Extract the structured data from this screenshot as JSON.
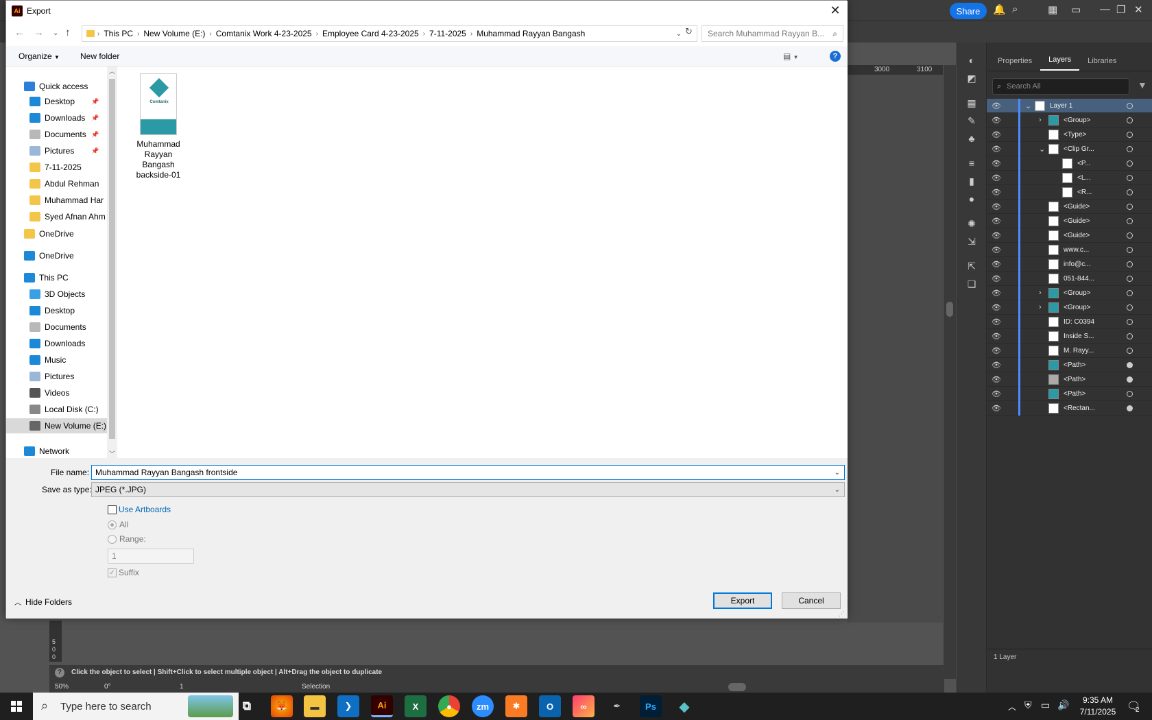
{
  "dialog": {
    "title": "Export",
    "close_glyph": "✕",
    "breadcrumbs": [
      "This PC",
      "New Volume (E:)",
      "Comtanix Work 4-23-2025",
      "Employee Card 4-23-2025",
      "7-11-2025",
      "Muhammad Rayyan Bangash"
    ],
    "search_placeholder": "Search Muhammad Rayyan B...",
    "organize_label": "Organize",
    "new_folder_label": "New folder",
    "help_glyph": "?",
    "nav": {
      "quick_access": "Quick access",
      "quick_items": [
        "Desktop",
        "Downloads",
        "Documents",
        "Pictures",
        "7-11-2025",
        "Abdul Rehman",
        "Muhammad Har",
        "Syed Afnan Ahm"
      ],
      "onedrive1": "OneDrive",
      "onedrive2": "OneDrive",
      "this_pc": "This PC",
      "pc_items": [
        "3D Objects",
        "Desktop",
        "Documents",
        "Downloads",
        "Music",
        "Pictures",
        "Videos",
        "Local Disk (C:)",
        "New Volume (E:)"
      ],
      "network": "Network"
    },
    "file": {
      "name_line1": "Muhammad",
      "name_line2": "Rayyan Bangash",
      "name_line3": "backside-01",
      "thumb_brand": "Comtanix"
    },
    "filename_label": "File name:",
    "filename_value": "Muhammad Rayyan Bangash frontside",
    "savetype_label": "Save as type:",
    "savetype_value": "JPEG (*.JPG)",
    "use_artboards": "Use Artboards",
    "all_label": "All",
    "range_label": "Range:",
    "range_value": "1",
    "suffix_label": "Suffix",
    "hide_folders": "Hide Folders",
    "export_btn": "Export",
    "cancel_btn": "Cancel"
  },
  "ai": {
    "share_label": "Share",
    "ruler_marks": [
      "3000",
      "3100"
    ],
    "left_ruler": [
      "5",
      "0",
      "0"
    ],
    "status_hint": "Click the object to select  |  Shift+Click to select multiple object  |  Alt+Drag the object to duplicate",
    "zoom": "50%",
    "rotation": "0°",
    "artboard_num": "1",
    "tool_name": "Selection",
    "panel_tabs": [
      "Properties",
      "Layers",
      "Libraries"
    ],
    "layer_search_placeholder": "Search All",
    "layers": [
      {
        "name": "Layer 1",
        "target": "hollow"
      },
      {
        "name": "<Group>",
        "target": "hollow"
      },
      {
        "name": "<Type>",
        "target": "hollow"
      },
      {
        "name": "<Clip Gr...",
        "target": "hollow"
      },
      {
        "name": "<P...",
        "target": "hollow"
      },
      {
        "name": "<L...",
        "target": "hollow"
      },
      {
        "name": "<R...",
        "target": "hollow"
      },
      {
        "name": "<Guide>",
        "target": "hollow"
      },
      {
        "name": "<Guide>",
        "target": "hollow"
      },
      {
        "name": "<Guide>",
        "target": "hollow"
      },
      {
        "name": "www.c...",
        "target": "hollow"
      },
      {
        "name": "info@c...",
        "target": "hollow"
      },
      {
        "name": "051-844...",
        "target": "hollow"
      },
      {
        "name": "<Group>",
        "target": "hollow"
      },
      {
        "name": "<Group>",
        "target": "hollow"
      },
      {
        "name": "ID: C0394",
        "target": "hollow"
      },
      {
        "name": "Inside S...",
        "target": "hollow"
      },
      {
        "name": "M. Rayy...",
        "target": "hollow"
      },
      {
        "name": "<Path>",
        "target": "filled"
      },
      {
        "name": "<Path>",
        "target": "filled"
      },
      {
        "name": "<Path>",
        "target": "hollow"
      },
      {
        "name": "<Rectan...",
        "target": "filled"
      }
    ],
    "layer_count": "1 Layer"
  },
  "taskbar": {
    "search_placeholder": "Type here to search",
    "time": "9:35 AM",
    "date": "7/11/2025",
    "notif_count": "2"
  }
}
